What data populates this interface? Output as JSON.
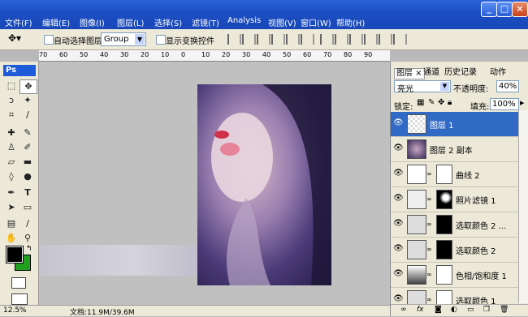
{
  "menubar": {
    "items": [
      "文件(F)",
      "编辑(E)",
      "图像(I)",
      "图层(L)",
      "选择(S)",
      "滤镜(T)",
      "Analysis",
      "视图(V)",
      "窗口(W)",
      "帮助(H)"
    ]
  },
  "window_controls": {
    "minimize": "_",
    "maximize": "□",
    "close": "×"
  },
  "options": {
    "auto_select_label": "自动选择图层",
    "group_value": "Group",
    "show_transform_label": "显示变换控件"
  },
  "ruler": {
    "ticks": [
      "70",
      "60",
      "50",
      "40",
      "30",
      "20",
      "10",
      "0",
      "10",
      "20",
      "30",
      "40",
      "50",
      "60",
      "70",
      "80",
      "90"
    ]
  },
  "toolbox": {
    "logo": "Ps"
  },
  "status": {
    "zoom": "12.5%",
    "doc_info": "文档:11.9M/39.6M"
  },
  "layers_panel": {
    "tabs": [
      "图层 ×",
      "通道",
      "历史记录",
      "动作"
    ],
    "blend_mode": "亮光",
    "opacity_label": "不透明度:",
    "opacity_value": "40%",
    "lock_label": "锁定:",
    "fill_label": "填充:",
    "fill_value": "100%",
    "layers": [
      {
        "name": "图层 1",
        "selected": true
      },
      {
        "name": "图层 2 副本",
        "selected": false
      },
      {
        "name": "曲线 2",
        "selected": false
      },
      {
        "name": "照片滤镜 1",
        "selected": false
      },
      {
        "name": "选取颜色 2 ...",
        "selected": false
      },
      {
        "name": "选取颜色 2",
        "selected": false
      },
      {
        "name": "色相/饱和度 1",
        "selected": false
      },
      {
        "name": "选取颜色 1",
        "selected": false
      }
    ],
    "bottom_icons": [
      "link-icon",
      "fx-icon",
      "mask-icon",
      "adjustment-icon",
      "folder-icon",
      "new-layer-icon",
      "trash-icon"
    ]
  },
  "colors": {
    "foreground": "#000000",
    "background": "#1fa01f",
    "selection": "#316ac5"
  }
}
